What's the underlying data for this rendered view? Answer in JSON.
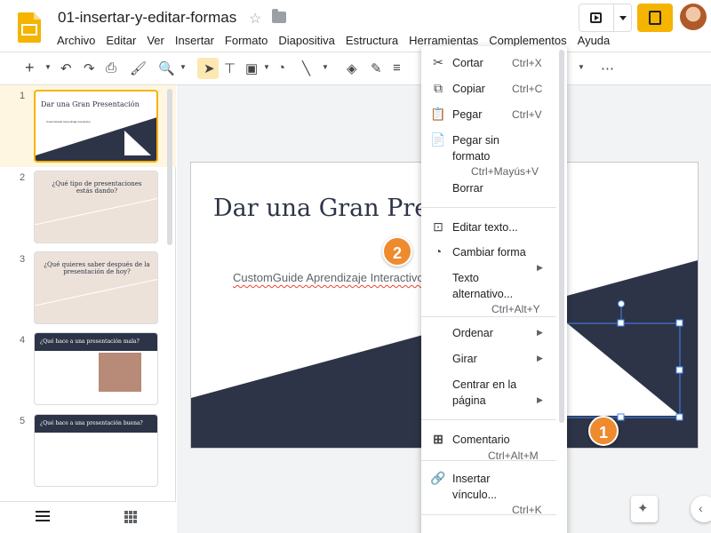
{
  "doc": {
    "title": "01-insertar-y-editar-formas"
  },
  "menubar": [
    "Archivo",
    "Editar",
    "Ver",
    "Insertar",
    "Formato",
    "Diapositiva",
    "Estructura",
    "Herramientas",
    "Complementos",
    "Ayuda"
  ],
  "thumbnails": [
    {
      "num": "1",
      "title": "Dar una Gran Presentación",
      "subtitle": "CustomGuide Aprendizaje Interactivo"
    },
    {
      "num": "2",
      "title": "¿Qué tipo de presentaciones estás dando?"
    },
    {
      "num": "3",
      "title": "¿Qué quieres saber después de la presentación de hoy?"
    },
    {
      "num": "4",
      "title": "¿Qué hace a una presentación mala?"
    },
    {
      "num": "5",
      "title": "¿Qué hace a una presentación buena?"
    }
  ],
  "slide": {
    "title": "Dar una Gran Presentación",
    "subtitle": "CustomGuide Aprendizaje Interactivo"
  },
  "context_menu": {
    "cut": {
      "label": "Cortar",
      "shortcut": "Ctrl+X"
    },
    "copy": {
      "label": "Copiar",
      "shortcut": "Ctrl+C"
    },
    "paste": {
      "label": "Pegar",
      "shortcut": "Ctrl+V"
    },
    "paste_plain": {
      "label_1": "Pegar sin",
      "label_2": "formato",
      "shortcut": "Ctrl+Mayús+V"
    },
    "delete": {
      "label": "Borrar"
    },
    "edit_text": {
      "label": "Editar texto..."
    },
    "change_shape": {
      "label": "Cambiar forma"
    },
    "alt_text": {
      "label_1": "Texto",
      "label_2": "alternativo...",
      "shortcut": "Ctrl+Alt+Y"
    },
    "order": {
      "label": "Ordenar"
    },
    "rotate": {
      "label": "Girar"
    },
    "center": {
      "label_1": "Centrar en la",
      "label_2": "página"
    },
    "comment": {
      "label": "Comentario",
      "shortcut": "Ctrl+Alt+M"
    },
    "link": {
      "label_1": "Insertar",
      "label_2": "vínculo...",
      "shortcut": "Ctrl+K"
    }
  },
  "callouts": {
    "one": "1",
    "two": "2"
  },
  "colors": {
    "accent": "#f4b400",
    "slide_dark": "#2d3447",
    "callout": "#ed8b2e",
    "selection": "#4285f4"
  }
}
